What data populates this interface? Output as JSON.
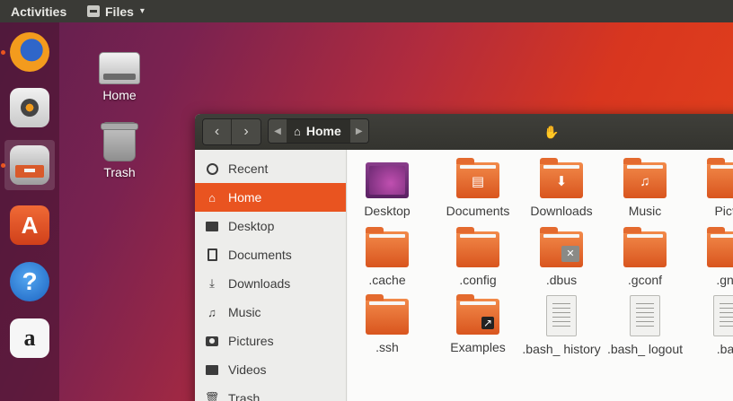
{
  "top_panel": {
    "activities": "Activities",
    "app_menu_label": "Files"
  },
  "dock": {
    "items": [
      {
        "name": "Firefox",
        "icon": "firefox-icon"
      },
      {
        "name": "Rhythmbox",
        "icon": "rhythmbox-icon"
      },
      {
        "name": "Files",
        "icon": "files-icon"
      },
      {
        "name": "Ubuntu Software",
        "icon": "software-store-icon",
        "glyph": "A"
      },
      {
        "name": "Help",
        "icon": "help-icon",
        "glyph": "?"
      },
      {
        "name": "Amazon",
        "icon": "amazon-icon",
        "glyph": "a"
      }
    ]
  },
  "desktop": {
    "icons": [
      {
        "label": "Home",
        "icon": "drive-icon"
      },
      {
        "label": "Trash",
        "icon": "trash-icon"
      }
    ]
  },
  "window": {
    "path": {
      "current": "Home"
    },
    "sidebar": [
      {
        "label": "Recent",
        "icon": "clock-icon"
      },
      {
        "label": "Home",
        "icon": "home-icon",
        "selected": true
      },
      {
        "label": "Desktop",
        "icon": "folder-icon"
      },
      {
        "label": "Documents",
        "icon": "document-icon"
      },
      {
        "label": "Downloads",
        "icon": "download-icon"
      },
      {
        "label": "Music",
        "icon": "music-icon"
      },
      {
        "label": "Pictures",
        "icon": "camera-icon"
      },
      {
        "label": "Videos",
        "icon": "video-icon"
      },
      {
        "label": "Trash",
        "icon": "trash-icon"
      }
    ],
    "files": [
      {
        "label": "Desktop",
        "type": "folder-desktop"
      },
      {
        "label": "Documents",
        "type": "folder"
      },
      {
        "label": "Downloads",
        "type": "folder"
      },
      {
        "label": "Music",
        "type": "folder"
      },
      {
        "label": "Pictu",
        "type": "folder"
      },
      {
        "label": ".cache",
        "type": "folder"
      },
      {
        "label": ".config",
        "type": "folder"
      },
      {
        "label": ".dbus",
        "type": "folder"
      },
      {
        "label": ".gconf",
        "type": "folder"
      },
      {
        "label": ".gnu",
        "type": "folder"
      },
      {
        "label": ".ssh",
        "type": "folder"
      },
      {
        "label": "Examples",
        "type": "folder"
      },
      {
        "label": ".bash_ history",
        "type": "file"
      },
      {
        "label": ".bash_ logout",
        "type": "file"
      },
      {
        "label": ".bas",
        "type": "file"
      }
    ]
  },
  "colors": {
    "accent": "#e95420",
    "panel": "#3a3a36",
    "headerbar": "#3a3a35",
    "sidebar_bg": "#ededeb",
    "content_bg": "#fbfbfa"
  }
}
